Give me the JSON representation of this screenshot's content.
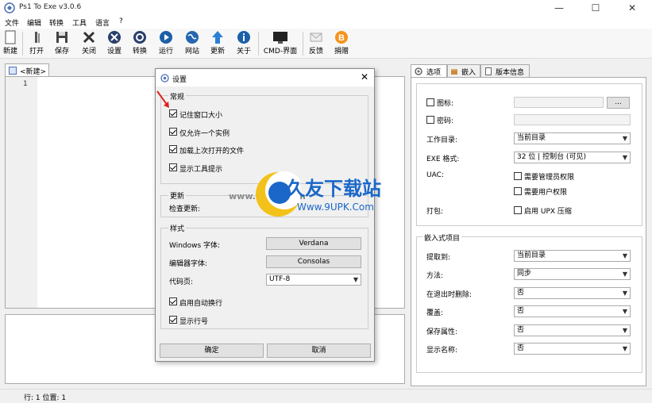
{
  "window": {
    "title": "Ps1 To Exe v3.0.6"
  },
  "menu": [
    "文件",
    "编辑",
    "转换",
    "工具",
    "语言",
    "?"
  ],
  "toolbar": [
    {
      "label": "新建",
      "icon": "new-file-icon"
    },
    {
      "label": "打开",
      "icon": "open-folder-icon"
    },
    {
      "label": "保存",
      "icon": "save-icon"
    },
    {
      "label": "关闭",
      "icon": "close-x-icon"
    },
    {
      "label": "设置",
      "icon": "tools-icon"
    },
    {
      "label": "转换",
      "icon": "gear-icon"
    },
    {
      "label": "运行",
      "icon": "play-icon"
    },
    {
      "label": "网站",
      "icon": "globe-icon"
    },
    {
      "label": "更新",
      "icon": "up-arrow-icon"
    },
    {
      "label": "关于",
      "icon": "info-icon"
    },
    {
      "label": "CMD-界面",
      "icon": "console-icon"
    },
    {
      "label": "反馈",
      "icon": "mail-icon"
    },
    {
      "label": "捐赠",
      "icon": "bitcoin-icon"
    }
  ],
  "editor": {
    "tab": "<新建>",
    "line_number": "1"
  },
  "status": {
    "text": "行: 1  位置: 1"
  },
  "right_tabs": [
    "选项",
    "嵌入",
    "版本信息"
  ],
  "options": {
    "icon_label": "图标:",
    "browse": "...",
    "password_label": "密码:",
    "workdir_label": "工作目录:",
    "workdir_value": "当前目录",
    "exe_format_label": "EXE 格式:",
    "exe_format_value": "32 位 | 控制台 (可见)",
    "uac_label": "UAC:",
    "uac_admin": "需要管理员权限",
    "uac_user": "需要用户权限",
    "pack_label": "打包:",
    "pack_upx": "启用 UPX 压缩",
    "embedded_group": "嵌入式项目",
    "extract_label": "提取到:",
    "extract_value": "当前目录",
    "method_label": "方法:",
    "method_value": "同步",
    "delete_label": "在退出时删除:",
    "delete_value": "否",
    "overwrite_label": "覆盖:",
    "overwrite_value": "否",
    "keepattr_label": "保存属性:",
    "keepattr_value": "否",
    "showname_label": "显示名称:",
    "showname_value": "否"
  },
  "dialog": {
    "title": "设置",
    "general": "常规",
    "remember_size": "记住窗口大小",
    "single_instance": "仅允许一个实例",
    "load_last": "加载上次打开的文件",
    "tooltips": "显示工具提示",
    "update_group": "更新",
    "check_update": "检查更新:",
    "style_group": "样式",
    "win_font_label": "Windows 字体:",
    "win_font": "Verdana",
    "editor_font_label": "编辑器字体:",
    "editor_font": "Consolas",
    "codepage_label": "代码页:",
    "codepage": "UTF-8",
    "word_wrap": "启用自动换行",
    "line_numbers": "显示行号",
    "ok": "确定",
    "cancel": "取消"
  },
  "watermark": {
    "brand": "久友下载站",
    "url_left": "www.9UPK.com",
    "url": "Www.9UPK.Com"
  }
}
